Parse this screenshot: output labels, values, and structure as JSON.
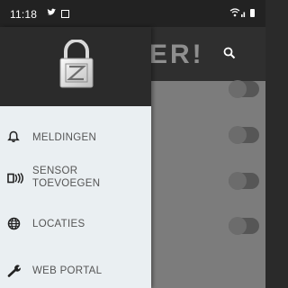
{
  "status_bar": {
    "time": "11:18",
    "icons": [
      "twitter-icon",
      "notification-square-icon",
      "wifi-icon",
      "signal-icon",
      "battery-icon"
    ]
  },
  "app_bar": {
    "title_fragment": "ER!",
    "search_icon": "search-icon"
  },
  "drawer": {
    "logo": "padlock-z-logo",
    "items": [
      {
        "label": "MELDINGEN",
        "icon": "bell-icon"
      },
      {
        "label": "SENSOR\nTOEVOEGEN",
        "icon": "sensor-icon"
      },
      {
        "label": "LOCATIES",
        "icon": "globe-icon"
      },
      {
        "label": "WEB PORTAL",
        "icon": "wrench-icon"
      }
    ]
  },
  "toggles": [
    {
      "on": false
    },
    {
      "on": false
    },
    {
      "on": false
    },
    {
      "on": false
    }
  ],
  "colors": {
    "drawer_header": "#2b2b2b",
    "drawer_menu": "#eaeff2",
    "menu_text": "#555555",
    "scrim": "#7c7c7c"
  }
}
